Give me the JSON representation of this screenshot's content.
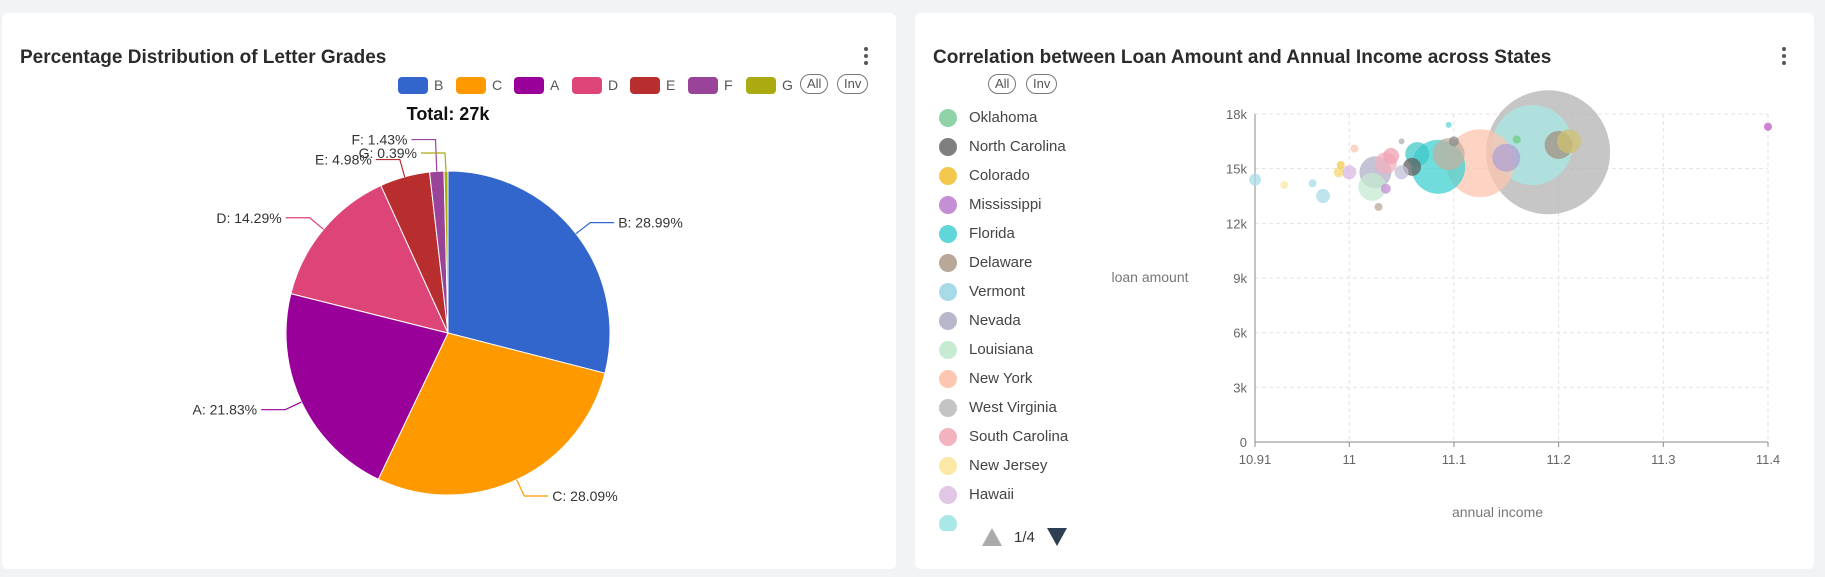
{
  "left_panel": {
    "title": "Percentage Distribution of Letter Grades",
    "all_label": "All",
    "inv_label": "Inv"
  },
  "right_panel": {
    "title": "Correlation between Loan Amount and Annual Income across States",
    "all_label": "All",
    "inv_label": "Inv",
    "pager_text": "1/4"
  },
  "chart_data": [
    {
      "type": "pie",
      "title": "Total: 27k",
      "legend_placement": "top-right",
      "legend": [
        "B",
        "C",
        "A",
        "D",
        "E",
        "F",
        "G"
      ],
      "slices": [
        {
          "name": "B",
          "percent": 28.99,
          "color": "#3366cc",
          "label": "B: 28.99%"
        },
        {
          "name": "C",
          "percent": 28.09,
          "color": "#ff9900",
          "label": "C: 28.09%"
        },
        {
          "name": "A",
          "percent": 21.83,
          "color": "#990099",
          "label": "A: 21.83%"
        },
        {
          "name": "D",
          "percent": 14.29,
          "color": "#dd4477",
          "label": "D: 14.29%"
        },
        {
          "name": "E",
          "percent": 4.98,
          "color": "#b82e2e",
          "label": "E: 4.98%"
        },
        {
          "name": "F",
          "percent": 1.43,
          "color": "#994499",
          "label": "F: 1.43%"
        },
        {
          "name": "G",
          "percent": 0.39,
          "color": "#aaaa11",
          "label": "G: 0.39%"
        }
      ]
    },
    {
      "type": "scatter",
      "subtype": "bubble",
      "title": "Correlation between Loan Amount and Annual Income across States",
      "xlabel": "annual income",
      "ylabel": "loan amount",
      "xlim": [
        10.91,
        11.4
      ],
      "ylim": [
        0,
        18000
      ],
      "xticks": [
        "10.91",
        "11",
        "11.1",
        "11.2",
        "11.3",
        "11.4"
      ],
      "yticks": [
        "0",
        "3k",
        "6k",
        "9k",
        "12k",
        "15k",
        "18k"
      ],
      "grid": true,
      "legend_placement": "left",
      "legend": [
        {
          "name": "Oklahoma",
          "color": "#8fd3a6"
        },
        {
          "name": "North Carolina",
          "color": "#7f7f7f"
        },
        {
          "name": "Colorado",
          "color": "#f2c94c"
        },
        {
          "name": "Mississippi",
          "color": "#c58fd6"
        },
        {
          "name": "Florida",
          "color": "#5fd6d8"
        },
        {
          "name": "Delaware",
          "color": "#b8a898"
        },
        {
          "name": "Vermont",
          "color": "#a8dbe8"
        },
        {
          "name": "Nevada",
          "color": "#b8b8cc"
        },
        {
          "name": "Louisiana",
          "color": "#c6ead2"
        },
        {
          "name": "New York",
          "color": "#fcc6b0"
        },
        {
          "name": "West Virginia",
          "color": "#c4c4c4"
        },
        {
          "name": "South Carolina",
          "color": "#f2b2be"
        },
        {
          "name": "New Jersey",
          "color": "#fbe8a6"
        },
        {
          "name": "Hawaii",
          "color": "#e2c6e6"
        }
      ],
      "points": [
        {
          "x": 11.19,
          "y": 15900,
          "r": 62,
          "color": "#b3b3b3"
        },
        {
          "x": 11.175,
          "y": 16300,
          "r": 40,
          "color": "#a8e8e6"
        },
        {
          "x": 11.125,
          "y": 15300,
          "r": 34,
          "color": "#fcc6b0"
        },
        {
          "x": 11.085,
          "y": 15100,
          "r": 27,
          "color": "#40d0d0"
        },
        {
          "x": 11.095,
          "y": 15800,
          "r": 16,
          "color": "#c0b0a0"
        },
        {
          "x": 11.15,
          "y": 15600,
          "r": 14,
          "color": "#b0a0d0"
        },
        {
          "x": 11.2,
          "y": 16300,
          "r": 14,
          "color": "#a09080"
        },
        {
          "x": 11.21,
          "y": 16500,
          "r": 12,
          "color": "#d0c070"
        },
        {
          "x": 11.025,
          "y": 14800,
          "r": 16,
          "color": "#b0b0c8"
        },
        {
          "x": 11.022,
          "y": 14000,
          "r": 14,
          "color": "#c6ead2"
        },
        {
          "x": 11.035,
          "y": 15300,
          "r": 11,
          "color": "#f2b2be"
        },
        {
          "x": 11.065,
          "y": 15800,
          "r": 12,
          "color": "#40c8c8"
        },
        {
          "x": 11.06,
          "y": 15100,
          "r": 9,
          "color": "#606060"
        },
        {
          "x": 11.05,
          "y": 14800,
          "r": 7,
          "color": "#c0c0d8"
        },
        {
          "x": 11.04,
          "y": 15700,
          "r": 8,
          "color": "#f0a0b0"
        },
        {
          "x": 11.0,
          "y": 14800,
          "r": 7,
          "color": "#d8b8e0"
        },
        {
          "x": 10.99,
          "y": 14800,
          "r": 5,
          "color": "#f5d76e"
        },
        {
          "x": 10.992,
          "y": 15200,
          "r": 4,
          "color": "#f2c94c"
        },
        {
          "x": 10.975,
          "y": 13500,
          "r": 7,
          "color": "#a8dbe8"
        },
        {
          "x": 10.91,
          "y": 14400,
          "r": 6,
          "color": "#a8dbe8"
        },
        {
          "x": 10.938,
          "y": 14100,
          "r": 4,
          "color": "#fbe8a6"
        },
        {
          "x": 10.965,
          "y": 14200,
          "r": 4,
          "color": "#a8dbe8"
        },
        {
          "x": 11.028,
          "y": 12900,
          "r": 4,
          "color": "#b8a898"
        },
        {
          "x": 11.035,
          "y": 13900,
          "r": 5,
          "color": "#c58fd6"
        },
        {
          "x": 11.005,
          "y": 16100,
          "r": 4,
          "color": "#fcc6b0"
        },
        {
          "x": 11.095,
          "y": 17400,
          "r": 3,
          "color": "#5fd6d8"
        },
        {
          "x": 11.1,
          "y": 16500,
          "r": 5,
          "color": "#8c8c8c"
        },
        {
          "x": 11.16,
          "y": 16600,
          "r": 4,
          "color": "#6ccf7c"
        },
        {
          "x": 11.05,
          "y": 16500,
          "r": 3,
          "color": "#b0b0b0"
        },
        {
          "x": 11.4,
          "y": 17300,
          "r": 4,
          "color": "#c058c8"
        }
      ]
    }
  ]
}
